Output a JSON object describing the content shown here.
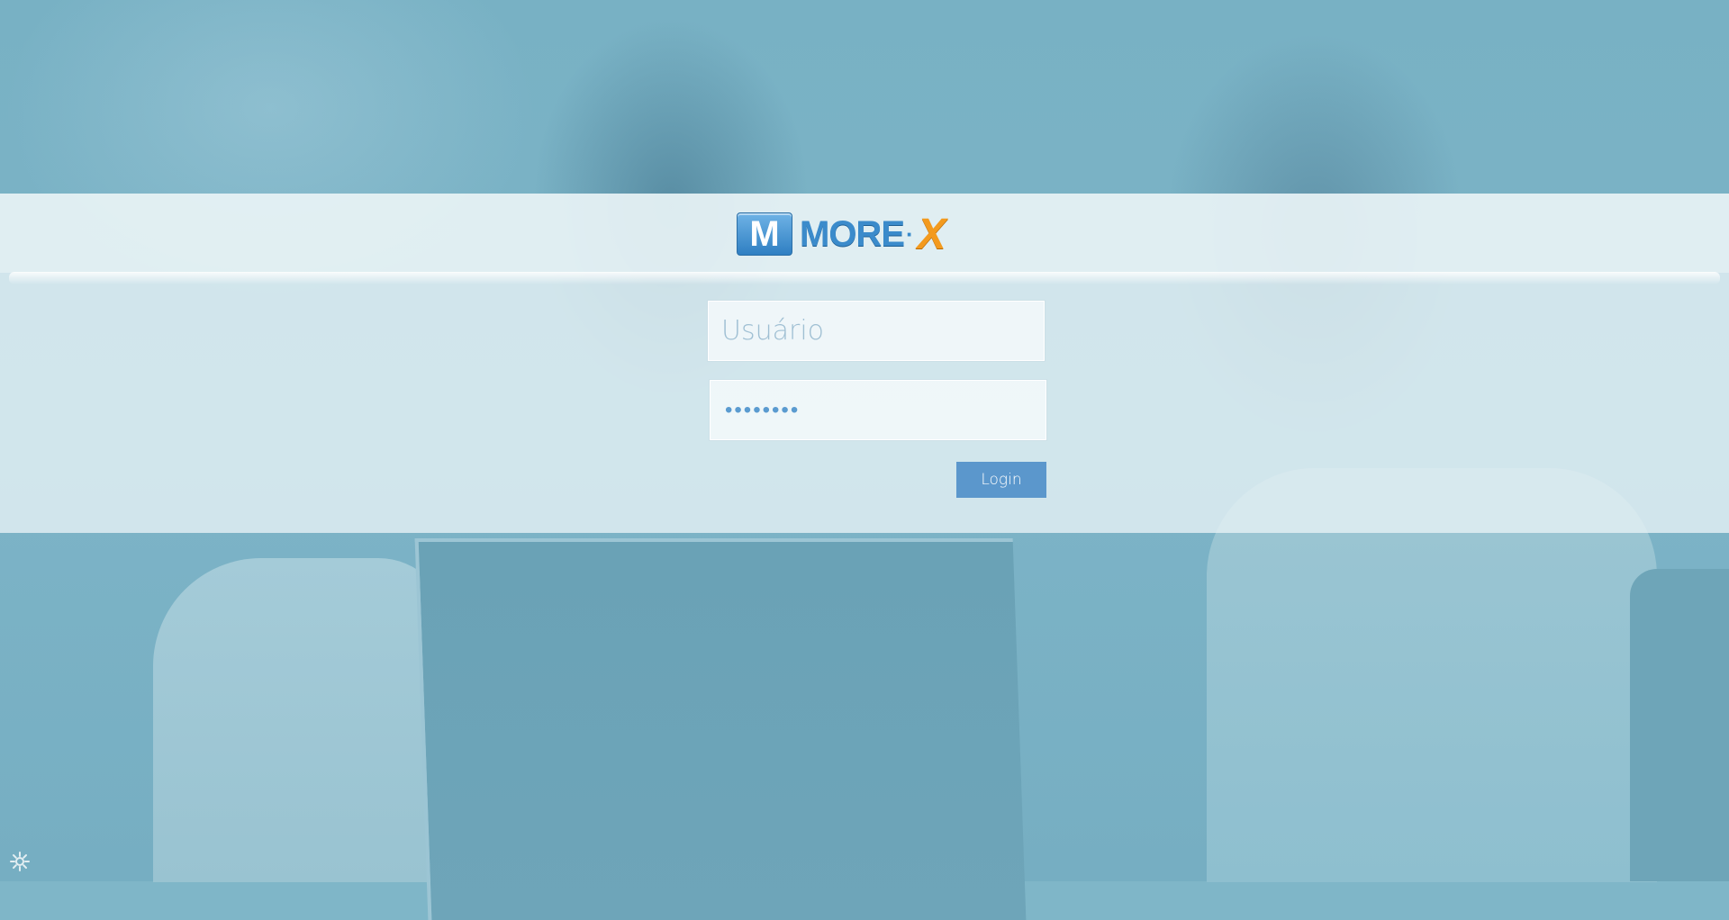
{
  "login": {
    "logo_text": "MORE·X",
    "logo_mark": "M",
    "logo_word": "MORE",
    "logo_separator": "·",
    "logo_x": "X",
    "username": {
      "value": "",
      "placeholder": "Usuário"
    },
    "password": {
      "value": "••••••••"
    },
    "button_label": "Login"
  },
  "icons": {
    "corner": "settings-gear-icon"
  },
  "colors": {
    "accent": "#5b97cc",
    "logo_blue": "#3b8bcb",
    "logo_orange": "#f39a1e",
    "background_tint": "#7fb6c8"
  }
}
